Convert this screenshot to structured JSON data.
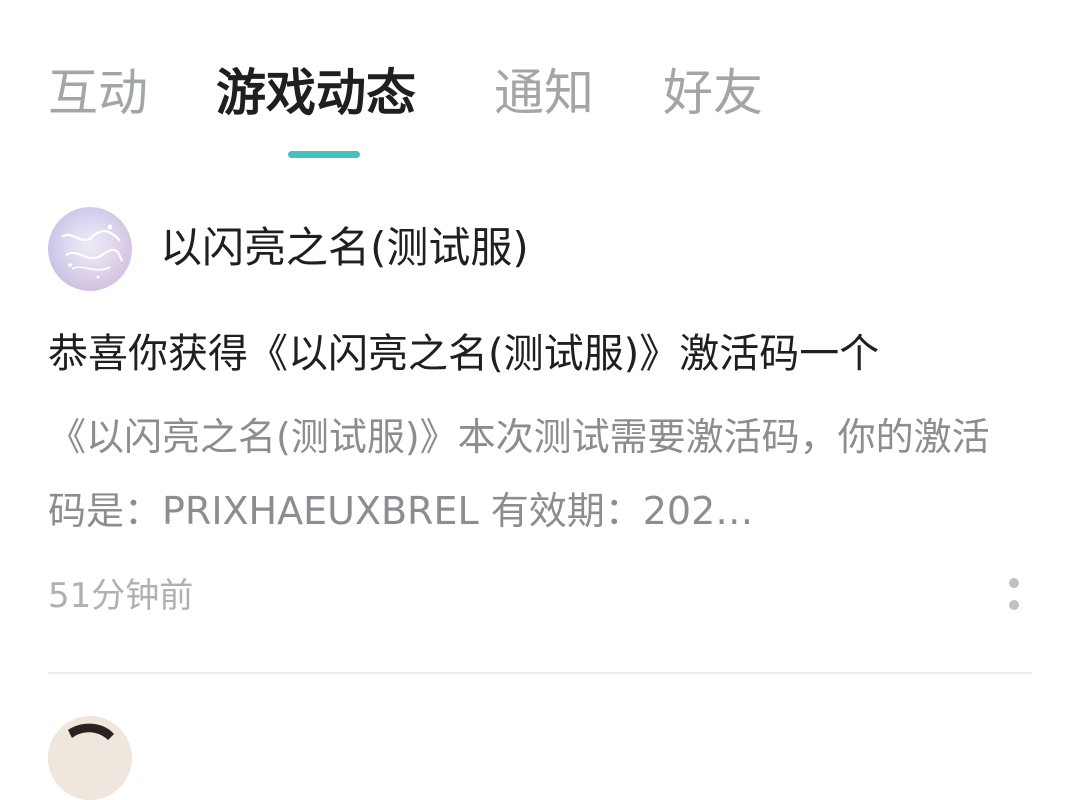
{
  "tabs": [
    {
      "label": "互动",
      "active": false
    },
    {
      "label": "游戏动态",
      "active": true
    },
    {
      "label": "通知",
      "active": false
    },
    {
      "label": "好友",
      "active": false
    }
  ],
  "colors": {
    "accent": "#45c2bf",
    "text_primary": "#1d1f20",
    "text_secondary": "#8b8e91",
    "tab_inactive": "#a3a6a8"
  },
  "message": {
    "sender": "以闪亮之名(测试服)",
    "avatar_icon": "game-logo-icon",
    "title": "恭喜你获得《以闪亮之名(测试服)》激活码一个",
    "body": "《以闪亮之名(测试服)》本次测试需要激活码，你的激活码是：PRIXHAEUXBREL 有效期：202…",
    "time": "51分钟前",
    "more_icon": "more-vertical-icon"
  }
}
